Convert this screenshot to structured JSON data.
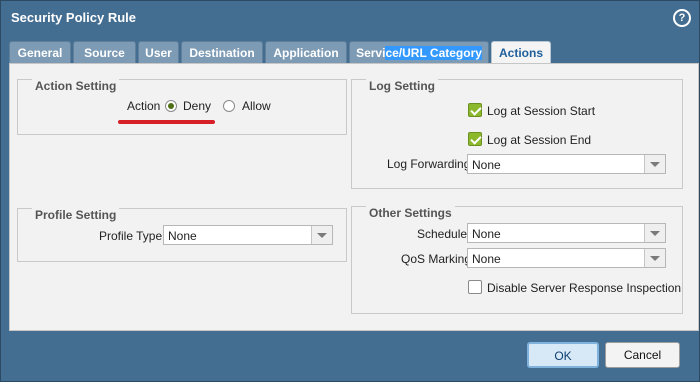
{
  "window": {
    "title": "Security Policy Rule",
    "help_icon": "?"
  },
  "tabs": [
    {
      "label": "General"
    },
    {
      "label": "Source"
    },
    {
      "label": "User"
    },
    {
      "label": "Destination"
    },
    {
      "label": "Application"
    },
    {
      "label_prefix": "Servi",
      "label_selected": "ce/URL Category"
    },
    {
      "label": "Actions"
    }
  ],
  "action_setting": {
    "title": "Action Setting",
    "action_label": "Action",
    "options": [
      {
        "label": "Deny",
        "selected": true
      },
      {
        "label": "Allow",
        "selected": false
      }
    ]
  },
  "log_setting": {
    "title": "Log Setting",
    "log_start": {
      "label": "Log at Session Start",
      "checked": true
    },
    "log_end": {
      "label": "Log at Session End",
      "checked": true
    },
    "log_forwarding": {
      "label": "Log Forwarding",
      "value": "None"
    }
  },
  "profile_setting": {
    "title": "Profile Setting",
    "profile_type": {
      "label": "Profile Type",
      "value": "None"
    }
  },
  "other_settings": {
    "title": "Other Settings",
    "schedule": {
      "label": "Schedule",
      "value": "None"
    },
    "qos": {
      "label": "QoS Marking",
      "value": "None"
    },
    "disable_inspection": {
      "label": "Disable Server Response Inspection",
      "checked": false
    }
  },
  "buttons": {
    "ok": "OK",
    "cancel": "Cancel"
  },
  "colors": {
    "annotation_underline": "#d61f26",
    "active_tab_text": "#1f5f9a",
    "checkbox_checked": "#8cb82c"
  }
}
